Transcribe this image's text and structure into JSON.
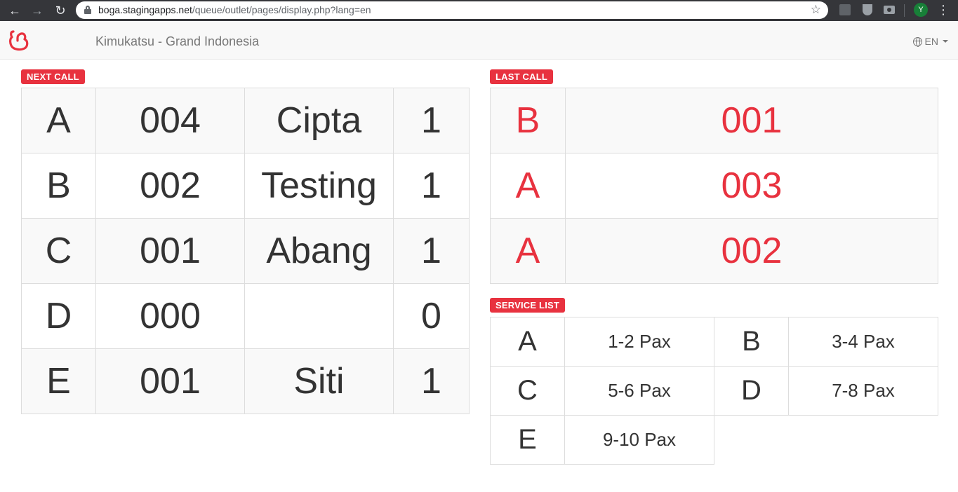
{
  "browser": {
    "url_host": "boga.stagingapps.net",
    "url_path": "/queue/outlet/pages/display.php?lang=en",
    "profile_initial": "Y"
  },
  "header": {
    "brand": "Kimukatsu - Grand Indonesia",
    "language": "EN",
    "logo_color": "#e8323f"
  },
  "next_call": {
    "label": "NEXT CALL",
    "rows": [
      {
        "code": "A",
        "number": "004",
        "name": "Cipta",
        "count": "1"
      },
      {
        "code": "B",
        "number": "002",
        "name": "Testing",
        "count": "1"
      },
      {
        "code": "C",
        "number": "001",
        "name": "Abang",
        "count": "1"
      },
      {
        "code": "D",
        "number": "000",
        "name": "",
        "count": "0"
      },
      {
        "code": "E",
        "number": "001",
        "name": "Siti",
        "count": "1"
      }
    ]
  },
  "last_call": {
    "label": "LAST CALL",
    "accent_color": "#e8323f",
    "rows": [
      {
        "code": "B",
        "number": "001"
      },
      {
        "code": "A",
        "number": "003"
      },
      {
        "code": "A",
        "number": "002"
      }
    ]
  },
  "service_list": {
    "label": "SERVICE LIST",
    "items": [
      {
        "code": "A",
        "desc": "1-2 Pax"
      },
      {
        "code": "B",
        "desc": "3-4 Pax"
      },
      {
        "code": "C",
        "desc": "5-6 Pax"
      },
      {
        "code": "D",
        "desc": "7-8 Pax"
      },
      {
        "code": "E",
        "desc": "9-10 Pax"
      }
    ]
  }
}
